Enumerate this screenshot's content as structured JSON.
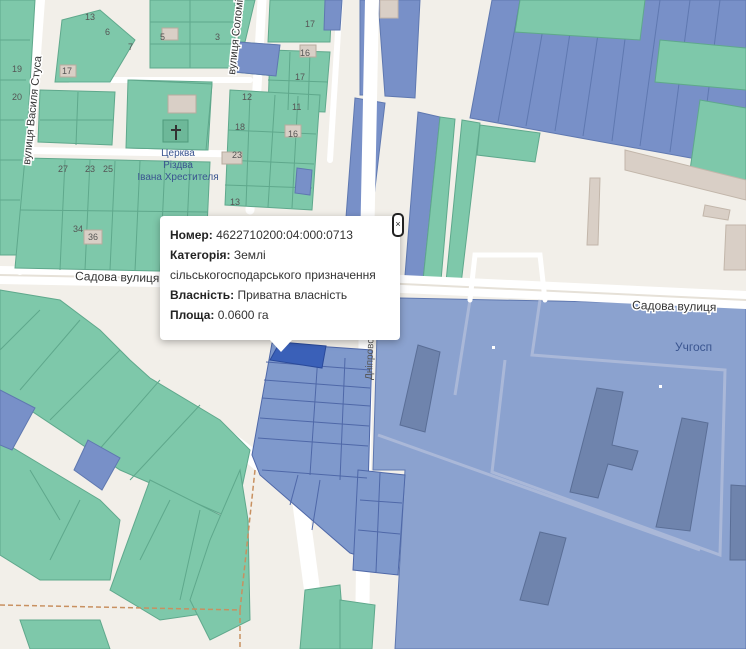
{
  "map": {
    "street_labels": {
      "sadova_left": "Садова вулиця",
      "sadova_right": "Садова вулиця",
      "vasyl_stus": "вулиця Василя Стуса",
      "solomiia": "вулиця Соломії",
      "dniprovska": "Дніпровська"
    },
    "place_label": "Учгосп",
    "church_label": [
      "Церква",
      "Різдва",
      "Івана Хрестителя"
    ],
    "house_numbers": [
      "13",
      "5",
      "3",
      "17",
      "16",
      "7",
      "6",
      "17",
      "19",
      "20",
      "17",
      "12",
      "11",
      "18",
      "16",
      "23",
      "27",
      "23",
      "25",
      "34",
      "36",
      "13"
    ]
  },
  "popup": {
    "number_label": "Номер:",
    "number_value": "4622710200:04:000:0713",
    "category_label": "Категорія:",
    "category_value_1": "Землі",
    "category_value_2": "сільськогосподарського призначення",
    "ownership_label": "Власність:",
    "ownership_value": "Приватна власність",
    "area_label": "Площа:",
    "area_value": "0.0600 га",
    "close_glyph": "×"
  },
  "colors": {
    "private_parcel": "#7ec8aa",
    "agri_parcel": "#7890c8",
    "highlight_parcel": "#3a60b8",
    "background": "#f2efe9"
  }
}
